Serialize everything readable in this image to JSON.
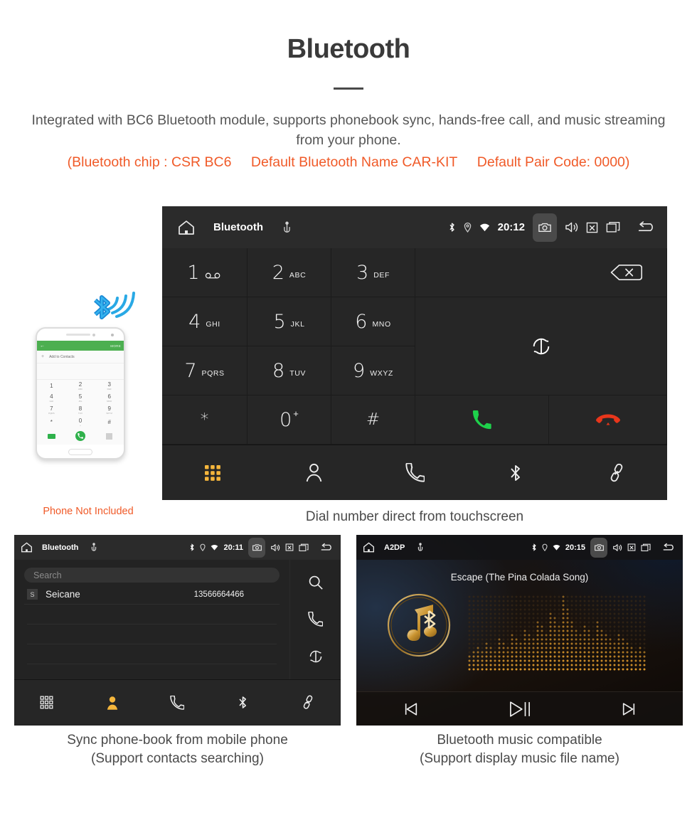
{
  "header": {
    "title": "Bluetooth",
    "lead": "Integrated with BC6 Bluetooth module, supports phonebook sync, hands-free call, and music streaming from your phone.",
    "spec_open": "(Bluetooth chip : CSR BC6",
    "spec_name": "Default Bluetooth Name CAR-KIT",
    "spec_pair": "Default Pair Code: 0000)",
    "accent_color": "#f05a28",
    "text_color": "#565656"
  },
  "dialer": {
    "topbar": {
      "home_icon": "home-icon",
      "title": "Bluetooth",
      "usb_icon": "usb-icon",
      "bluetooth_icon": "bluetooth-icon",
      "location_icon": "location-icon",
      "wifi_icon": "wifi-icon",
      "clock": "20:12",
      "camera_icon": "camera-icon",
      "volume_icon": "volume-icon",
      "mute_icon": "mute-box-icon",
      "recents_icon": "recents-icon",
      "back_icon": "back-icon"
    },
    "keys": [
      {
        "num": "1",
        "sub": "",
        "glyph": "voicemail-glyph"
      },
      {
        "num": "2",
        "sub": "ABC",
        "glyph": ""
      },
      {
        "num": "3",
        "sub": "DEF",
        "glyph": ""
      },
      {
        "num": "4",
        "sub": "GHI",
        "glyph": ""
      },
      {
        "num": "5",
        "sub": "JKL",
        "glyph": ""
      },
      {
        "num": "6",
        "sub": "MNO",
        "glyph": ""
      },
      {
        "num": "7",
        "sub": "PQRS",
        "glyph": ""
      },
      {
        "num": "8",
        "sub": "TUV",
        "glyph": ""
      },
      {
        "num": "9",
        "sub": "WXYZ",
        "glyph": ""
      },
      {
        "num": "*",
        "sub": "",
        "glyph": ""
      },
      {
        "num": "0",
        "sub": "",
        "glyph": "plus-superscript"
      },
      {
        "num": "#",
        "sub": "",
        "glyph": ""
      }
    ],
    "zero_sup": "+",
    "backspace_icon": "backspace-icon",
    "sync_icon": "sync-icon",
    "call_icon": "call-answer-icon",
    "call_color": "#1ed14b",
    "hangup_icon": "call-end-icon",
    "hangup_color": "#e8361b",
    "bottom_nav": [
      {
        "name": "dialpad",
        "icon": "dialpad-icon",
        "active": true
      },
      {
        "name": "contacts",
        "icon": "contact-person-icon",
        "active": false
      },
      {
        "name": "call-log",
        "icon": "phone-handset-icon",
        "active": false
      },
      {
        "name": "bluetooth",
        "icon": "bluetooth-icon",
        "active": false
      },
      {
        "name": "link",
        "icon": "link-chain-icon",
        "active": false
      }
    ],
    "active_color": "#f5b63c",
    "caption": "Dial number direct from touchscreen"
  },
  "phone_mock": {
    "bluetooth_wave_icon": "bluetooth-signal-icon",
    "bluetooth_color": "#1aa3e8",
    "screen": {
      "back_icon": "back-arrow-icon",
      "more_label": "MORE",
      "add_label": "Add to Contacts",
      "add_icon": "plus-icon",
      "keys": [
        {
          "n": "1",
          "l": ""
        },
        {
          "n": "2",
          "l": "ABC"
        },
        {
          "n": "3",
          "l": "DEF"
        },
        {
          "n": "4",
          "l": "GHI"
        },
        {
          "n": "5",
          "l": "JKL"
        },
        {
          "n": "6",
          "l": "MNO"
        },
        {
          "n": "7",
          "l": "PQRS"
        },
        {
          "n": "8",
          "l": "TUV"
        },
        {
          "n": "9",
          "l": "WXYZ"
        },
        {
          "n": "*",
          "l": ""
        },
        {
          "n": "0",
          "l": "+"
        },
        {
          "n": "#",
          "l": ""
        }
      ],
      "video_icon": "video-call-icon",
      "call_icon": "call-answer-icon",
      "keyboard_icon": "keypad-icon"
    },
    "note": "Phone Not Included"
  },
  "phonebook": {
    "topbar": {
      "home_icon": "home-icon",
      "title": "Bluetooth",
      "usb_icon": "usb-icon",
      "clock": "20:11",
      "camera_icon": "camera-icon",
      "volume_icon": "volume-icon",
      "mute_icon": "mute-box-icon",
      "recents_icon": "recents-icon",
      "back_icon": "back-icon"
    },
    "search_placeholder": "Search",
    "contacts": [
      {
        "initial": "S",
        "name": "Seicane",
        "number": "13566664466"
      }
    ],
    "side_actions": [
      {
        "name": "search",
        "icon": "search-icon"
      },
      {
        "name": "dial",
        "icon": "phone-handset-icon"
      },
      {
        "name": "sync",
        "icon": "sync-icon"
      }
    ],
    "bottom_nav": [
      {
        "name": "dialpad",
        "icon": "dialpad-icon",
        "active": false
      },
      {
        "name": "contacts",
        "icon": "contact-person-filled-icon",
        "active": true
      },
      {
        "name": "call-log",
        "icon": "phone-handset-icon",
        "active": false
      },
      {
        "name": "bluetooth",
        "icon": "bluetooth-icon",
        "active": false
      },
      {
        "name": "link",
        "icon": "link-chain-icon",
        "active": false
      }
    ],
    "caption_line1": "Sync phone-book from mobile phone",
    "caption_line2": "(Support contacts searching)"
  },
  "music": {
    "topbar": {
      "home_icon": "home-icon",
      "title": "A2DP",
      "usb_icon": "usb-icon",
      "clock": "20:15",
      "camera_icon": "camera-icon",
      "volume_icon": "volume-icon",
      "mute_icon": "mute-box-icon",
      "recents_icon": "recents-icon",
      "back_icon": "back-icon"
    },
    "song_title": "Escape (The Pina Colada Song)",
    "album_icon": "music-note-bluetooth-icon",
    "visualizer_icon": "dot-matrix-spectrum",
    "accent_color": "#d9962c",
    "controls": [
      {
        "name": "previous",
        "icon": "skip-previous-icon"
      },
      {
        "name": "play-pause",
        "icon": "play-pause-icon"
      },
      {
        "name": "next",
        "icon": "skip-next-icon"
      }
    ],
    "caption_line1": "Bluetooth music compatible",
    "caption_line2": "(Support display music file name)"
  }
}
